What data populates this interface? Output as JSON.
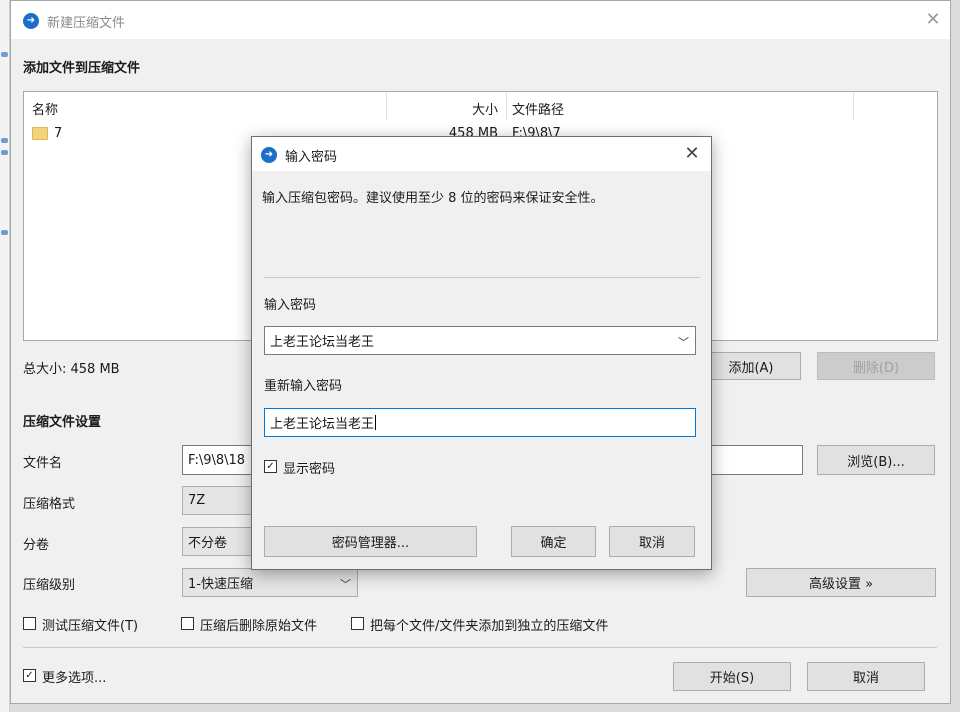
{
  "main": {
    "title": "新建压缩文件",
    "add_files_title": "添加文件到压缩文件",
    "columns": {
      "name": "名称",
      "size": "大小",
      "path": "文件路径"
    },
    "files": [
      {
        "name": "7",
        "size": "458 MB",
        "path": "F:\\9\\8\\7"
      }
    ],
    "total_size": "总大小: 458 MB",
    "add_button": "添加(A)",
    "delete_button": "删除(D)",
    "settings_title": "压缩文件设置",
    "filename_label": "文件名",
    "filename_value": "F:\\9\\8\\18",
    "browse_button": "浏览(B)...",
    "format_label": "压缩格式",
    "format_value": "7Z",
    "split_label": "分卷",
    "split_value": "不分卷",
    "level_label": "压缩级别",
    "level_value": "1-快速压缩",
    "advanced_button": "高级设置 »",
    "test_checkbox": "测试压缩文件(T)",
    "delete_after_checkbox": "压缩后删除原始文件",
    "separate_checkbox": "把每个文件/文件夹添加到独立的压缩文件",
    "more_options_checkbox": "更多选项...",
    "start_button": "开始(S)",
    "cancel_button": "取消"
  },
  "password_dialog": {
    "title": "输入密码",
    "hint": "输入压缩包密码。建议使用至少 8 位的密码来保证安全性。",
    "password_label": "输入密码",
    "password_value": "上老王论坛当老王",
    "confirm_label": "重新输入密码",
    "confirm_value": "上老王论坛当老王",
    "show_password": "显示密码",
    "manager_button": "密码管理器...",
    "ok_button": "确定",
    "cancel_button": "取消"
  }
}
